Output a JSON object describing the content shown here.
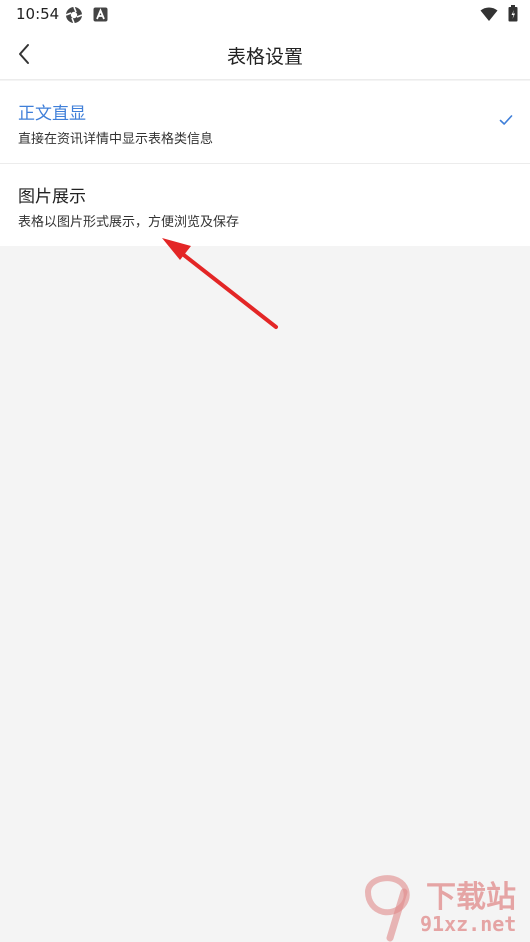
{
  "status_bar": {
    "time": "10:54",
    "icons": [
      "aperture-icon",
      "a-badge-icon",
      "wifi-icon",
      "battery-icon"
    ]
  },
  "header": {
    "back_icon": "chevron-left-icon",
    "title": "表格设置"
  },
  "options": [
    {
      "title": "正文直显",
      "description": "直接在资讯详情中显示表格类信息",
      "selected": true
    },
    {
      "title": "图片展示",
      "description": "表格以图片形式展示，方便浏览及保存",
      "selected": false
    }
  ],
  "annotation": {
    "color": "#e32626"
  },
  "watermark": {
    "text": "下载站",
    "url_text": "91xz.net"
  },
  "colors": {
    "accent": "#3f7fd9",
    "background": "#f4f4f4",
    "surface": "#ffffff"
  }
}
